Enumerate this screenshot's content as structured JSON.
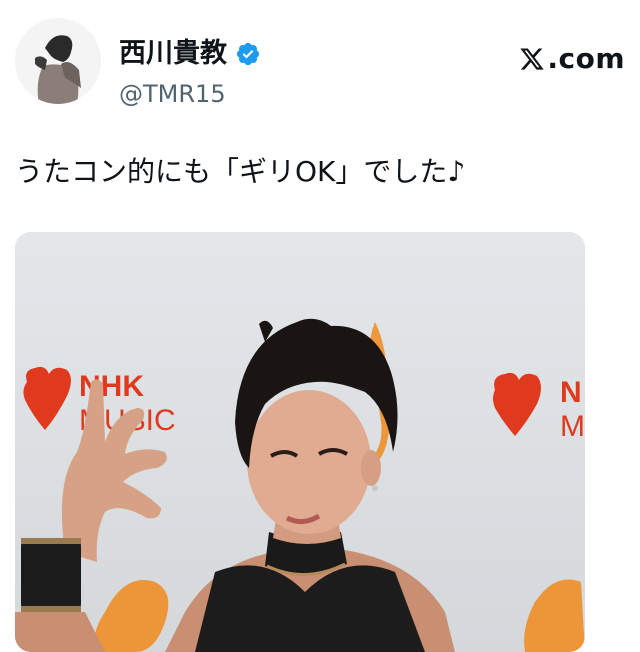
{
  "author": {
    "display_name": "西川貴教",
    "handle": "@TMR15",
    "verified": true,
    "avatar_icon": "profile-photo"
  },
  "brand": {
    "logo_icon": "x-logo",
    "label": ".com"
  },
  "tweet": {
    "text": "うたコン的にも「ギリOK」でした♪"
  },
  "media": {
    "backdrop": {
      "logo_text_left_1": "NHK",
      "logo_text_left_2": "MUSIC",
      "logo_text_right_1": "N",
      "logo_text_right_2": "M"
    }
  },
  "colors": {
    "verified_blue": "#1d9bf0",
    "handle_gray": "#536471",
    "nhk_red": "#e03a1e",
    "flame_orange": "#f08a1c"
  }
}
